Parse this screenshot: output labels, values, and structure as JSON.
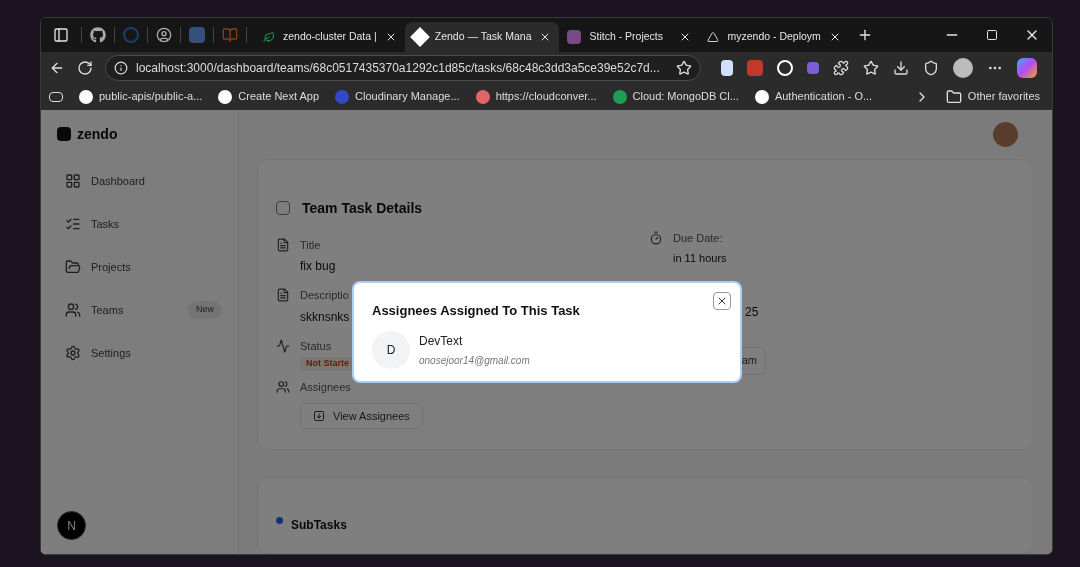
{
  "browser": {
    "tabs": [
      {
        "title": "zendo-cluster Data |",
        "selected": false
      },
      {
        "title": "Zendo — Task Mana",
        "selected": true
      },
      {
        "title": "Stitch - Projects",
        "selected": false
      },
      {
        "title": "myzendo - Deploym",
        "selected": false
      }
    ],
    "address": "localhost:3000/dashboard/teams/68c0517435370a1292c1d85c/tasks/68c48c3dd3a5ce39e52c7d...",
    "bookmarks": [
      "public-apis/public-a...",
      "Create Next App",
      "Cloudinary Manage...",
      "https://cloudconver...",
      "Cloud: MongoDB Cl...",
      "Authentication - O..."
    ],
    "other_favorites": "Other favorites"
  },
  "app": {
    "logo": "zendo",
    "sidebar": [
      {
        "label": "Dashboard"
      },
      {
        "label": "Tasks"
      },
      {
        "label": "Projects"
      },
      {
        "label": "Teams",
        "badge": "New"
      },
      {
        "label": "Settings"
      }
    ],
    "dev_badge": "N",
    "task": {
      "checked": false,
      "heading": "Team Task Details",
      "title_label": "Title",
      "title": "fix bug",
      "description_label": "Descriptio",
      "description": "skknsnks",
      "status_label": "Status",
      "status": "Not Starte",
      "assignees_label": "Assignees",
      "view_button": "View Assignees",
      "due_label": "Due Date:",
      "due": "in 11 hours",
      "date_fragment": "25",
      "button_fragment": "am"
    },
    "subtasks": "SubTasks"
  },
  "modal": {
    "title": "Assignees Assigned To This Task",
    "assignees": [
      {
        "initial": "D",
        "name": "DevText",
        "email": "onosejoor14@gmail.com"
      }
    ]
  }
}
